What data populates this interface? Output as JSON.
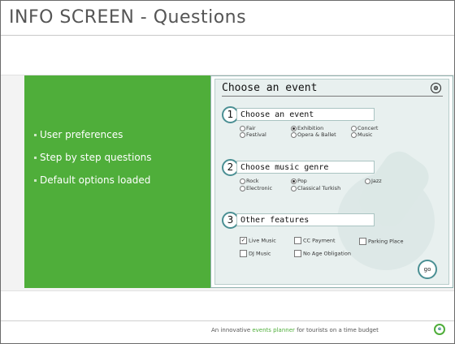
{
  "slide": {
    "title": "INFO SCREEN - Questions"
  },
  "bullets": [
    "User preferences",
    "Step by step questions",
    "Default options loaded"
  ],
  "app": {
    "title": "Choose an event",
    "close_symbol": "⊗",
    "steps": [
      {
        "number": "1",
        "label": "Choose an event",
        "options": [
          {
            "label": "Fair",
            "selected": false
          },
          {
            "label": "Exhibition",
            "selected": true
          },
          {
            "label": "Concert",
            "selected": false
          },
          {
            "label": "Festival",
            "selected": false
          },
          {
            "label": "Opera & Ballet",
            "selected": false
          },
          {
            "label": "Music",
            "selected": false
          }
        ]
      },
      {
        "number": "2",
        "label": "Choose music genre",
        "options": [
          {
            "label": "Rock",
            "selected": false
          },
          {
            "label": "Pop",
            "selected": true
          },
          {
            "label": "Jazz",
            "selected": false
          },
          {
            "label": "Electronic",
            "selected": false
          },
          {
            "label": "Classical Turkish",
            "selected": false
          }
        ]
      },
      {
        "number": "3",
        "label": "Other features",
        "checkboxes": [
          {
            "label": "Live Music",
            "checked": true
          },
          {
            "label": "CC Payment",
            "checked": false
          },
          {
            "label": "Parking Place",
            "checked": false
          },
          {
            "label": "DJ Music",
            "checked": false
          },
          {
            "label": "No Age Obligation",
            "checked": false
          }
        ]
      }
    ],
    "go_label": "go"
  },
  "footer": {
    "text_before": "An innovative ",
    "highlight": "events planner",
    "text_after": " for tourists on a time budget",
    "logo_text": "e"
  },
  "colors": {
    "green": "#4fae3a",
    "teal": "#4a8f93"
  },
  "icons": {
    "close": "close-icon",
    "logo": "logo-icon"
  }
}
